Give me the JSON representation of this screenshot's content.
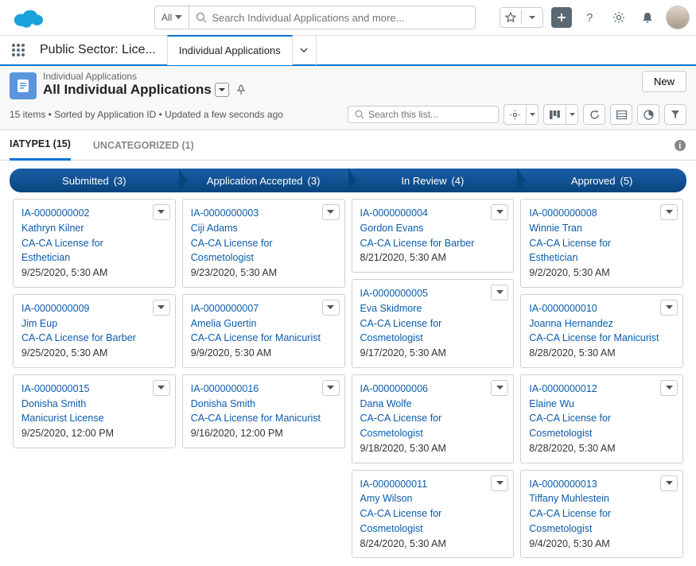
{
  "header": {
    "search_scope": "All",
    "search_placeholder": "Search Individual Applications and more..."
  },
  "nav": {
    "app_name": "Public Sector: Lice...",
    "tab": "Individual Applications"
  },
  "page": {
    "object_label": "Individual Applications",
    "list_view": "All Individual Applications",
    "new_button": "New",
    "meta": "15 items • Sorted by Application ID • Updated a few seconds ago",
    "list_search_placeholder": "Search this list..."
  },
  "tabs": {
    "t1_label": "IATYPE1",
    "t1_count": "(15)",
    "t2_label": "UNCATEGORIZED",
    "t2_count": "(1)"
  },
  "columns": [
    {
      "title": "Submitted",
      "count": "(3)"
    },
    {
      "title": "Application Accepted",
      "count": "(3)"
    },
    {
      "title": "In Review",
      "count": "(4)"
    },
    {
      "title": "Approved",
      "count": "(5)"
    }
  ],
  "cards": {
    "c0": [
      {
        "id": "IA-0000000002",
        "name": "Kathryn Kilner",
        "lic": "CA-CA License for Esthetician",
        "date": "9/25/2020, 5:30 AM"
      },
      {
        "id": "IA-0000000009",
        "name": "Jim Eup",
        "lic": "CA-CA License for Barber",
        "date": "9/25/2020, 5:30 AM"
      },
      {
        "id": "IA-0000000015",
        "name": "Donisha Smith",
        "lic": "Manicurist License",
        "date": "9/25/2020, 12:00 PM"
      }
    ],
    "c1": [
      {
        "id": "IA-0000000003",
        "name": "Ciji Adams",
        "lic": "CA-CA License for Cosmetologist",
        "date": "9/23/2020, 5:30 AM"
      },
      {
        "id": "IA-0000000007",
        "name": "Amelia Guertin",
        "lic": "CA-CA License for Manicurist",
        "date": "9/9/2020, 5:30 AM"
      },
      {
        "id": "IA-0000000016",
        "name": "Donisha Smith",
        "lic": "CA-CA License for Manicurist",
        "date": "9/16/2020, 12:00 PM"
      }
    ],
    "c2": [
      {
        "id": "IA-0000000004",
        "name": "Gordon Evans",
        "lic": "CA-CA License for Barber",
        "date": "8/21/2020, 5:30 AM"
      },
      {
        "id": "IA-0000000005",
        "name": "Eva Skidmore",
        "lic": "CA-CA License for Cosmetologist",
        "date": "9/17/2020, 5:30 AM"
      },
      {
        "id": "IA-0000000006",
        "name": "Dana Wolfe",
        "lic": "CA-CA License for Cosmetologist",
        "date": "9/18/2020, 5:30 AM"
      },
      {
        "id": "IA-0000000011",
        "name": "Amy Wilson",
        "lic": "CA-CA License for Cosmetologist",
        "date": "8/24/2020, 5:30 AM"
      }
    ],
    "c3": [
      {
        "id": "IA-0000000008",
        "name": "Winnie Tran",
        "lic": "CA-CA License for Esthetician",
        "date": "9/2/2020, 5:30 AM"
      },
      {
        "id": "IA-0000000010",
        "name": "Joanna Hernandez",
        "lic": "CA-CA License for Manicurist",
        "date": "8/28/2020, 5:30 AM"
      },
      {
        "id": "IA-0000000012",
        "name": "Elaine Wu",
        "lic": "CA-CA License for Cosmetologist",
        "date": "8/28/2020, 5:30 AM"
      },
      {
        "id": "IA-0000000013",
        "name": "Tiffany Muhlestein",
        "lic": "CA-CA License for Cosmetologist",
        "date": "9/4/2020, 5:30 AM"
      }
    ]
  }
}
